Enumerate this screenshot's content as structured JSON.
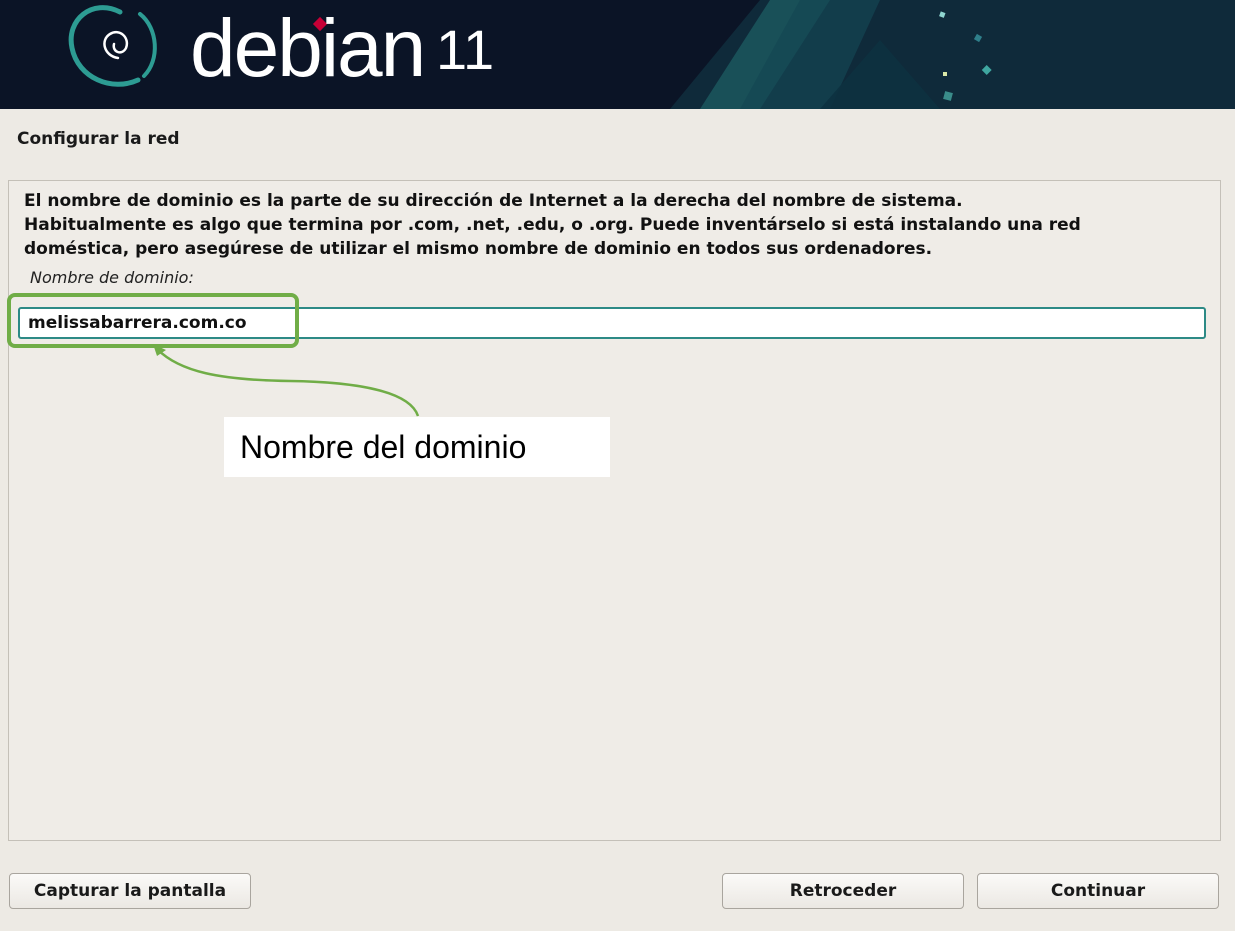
{
  "banner": {
    "logo_text": "debian",
    "version": "11"
  },
  "page": {
    "title": "Configurar la red"
  },
  "dialog": {
    "description": "El nombre de dominio es la parte de su dirección de Internet a la derecha del nombre de sistema.\nHabitualmente es algo que termina por .com, .net, .edu, o .org. Puede inventárselo si está instalando una red\ndoméstica, pero asegúrese de utilizar el mismo nombre de dominio en todos sus ordenadores.",
    "field_label": "Nombre de dominio:",
    "field_value": "melissabarrera.com.co"
  },
  "annotation": {
    "callout_text": "Nombre del dominio",
    "color": "#70ad47"
  },
  "buttons": {
    "screenshot": "Capturar la pantalla",
    "back": "Retroceder",
    "continue": "Continuar"
  },
  "colors": {
    "banner_bg": "#0b1426",
    "accent_teal": "#2d8a86",
    "debian_red": "#c70036"
  }
}
